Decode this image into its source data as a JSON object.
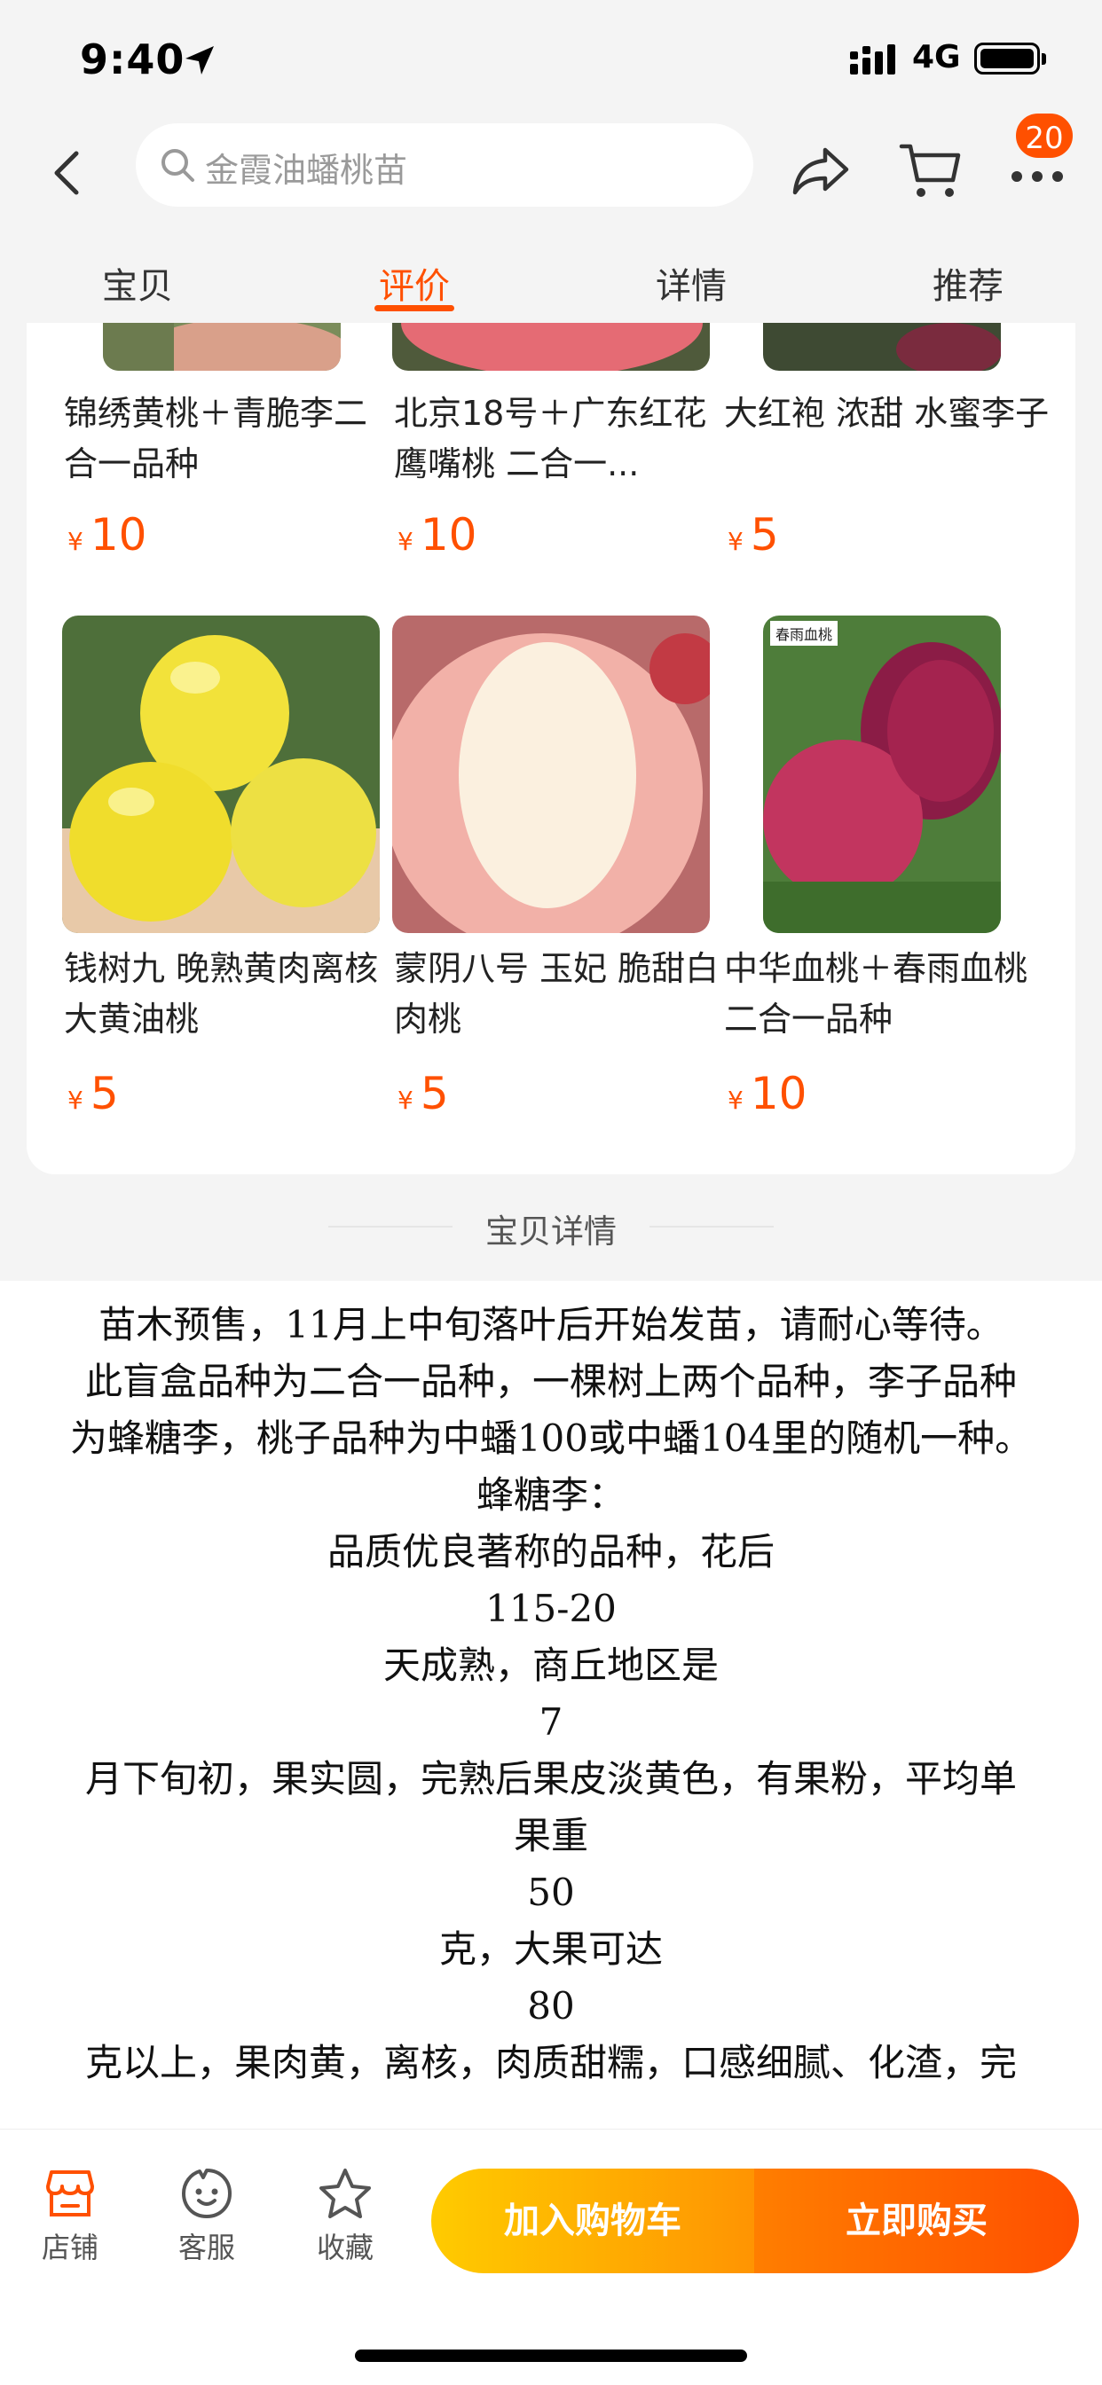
{
  "status_bar": {
    "time": "9:40",
    "network": "4G"
  },
  "header": {
    "search_text": "金霞油蟠桃苗",
    "cart_badge": "20"
  },
  "tabs": [
    {
      "label": "宝贝",
      "active": false
    },
    {
      "label": "评价",
      "active": true
    },
    {
      "label": "详情",
      "active": false
    },
    {
      "label": "推荐",
      "active": false
    }
  ],
  "products": [
    {
      "name": "锦绣黄桃＋青脆李二合一品种",
      "price": "10"
    },
    {
      "name": "北京18号＋广东红花鹰嘴桃 二合一...",
      "price": "10"
    },
    {
      "name": "大红袍 浓甜 水蜜李子",
      "price": "5"
    },
    {
      "name": "钱树九 晚熟黄肉离核 大黄油桃",
      "price": "5"
    },
    {
      "name": "蒙阴八号  玉妃  脆甜白肉桃",
      "price": "5"
    },
    {
      "name": "中华血桃＋春雨血桃二合一品种",
      "price": "10"
    }
  ],
  "currency_symbol": "¥",
  "image_labels": {
    "blood_peach_tag": "春雨血桃"
  },
  "section_title": "宝贝详情",
  "detail_lines": [
    "苗木预售，11月上中旬落叶后开始发苗，请耐心等待。",
    "此盲盒品种为二合一品种，一棵树上两个品种，李子品种",
    "为蜂糖李，桃子品种为中蟠100或中蟠104里的随机一种。",
    "蜂糖李：",
    "品质优良著称的品种，花后",
    "115-20",
    "天成熟，商丘地区是",
    "7",
    "月下旬初，果实圆，完熟后果皮淡黄色，有果粉，平均单",
    "果重",
    "50",
    "克，大果可达",
    "80",
    "克以上，果肉黄，离核，肉质甜糯，口感细腻、化渣，完"
  ],
  "bottom_bar": {
    "store": "店铺",
    "service": "客服",
    "favorite": "收藏",
    "add_to_cart": "加入购物车",
    "buy_now": "立即购买"
  },
  "colors": {
    "accent": "#ff5000",
    "cart_button": "#ffb300",
    "buy_button": "#ff6a00"
  }
}
